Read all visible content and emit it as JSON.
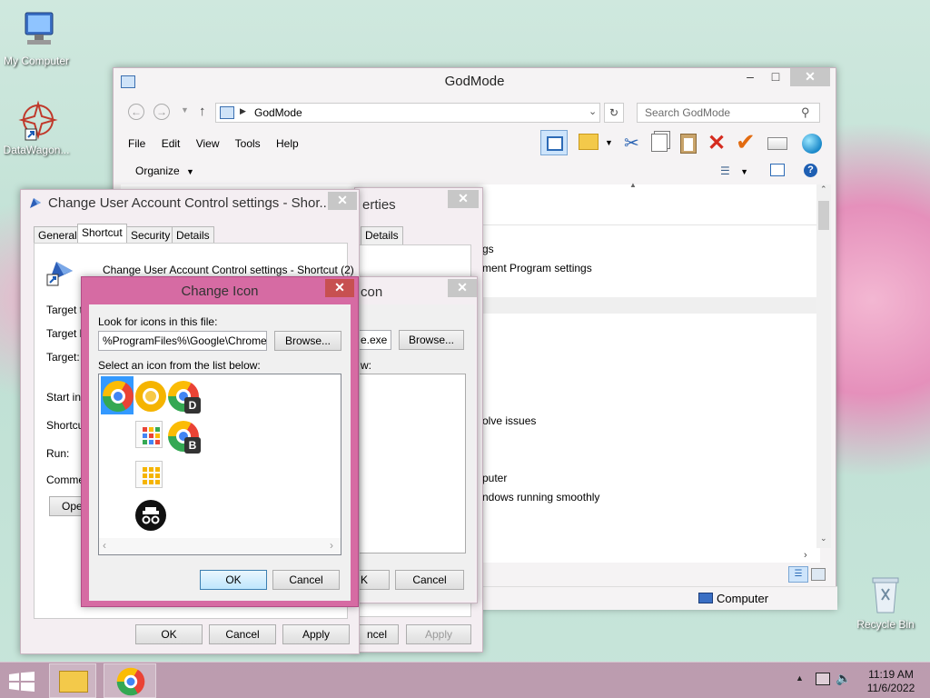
{
  "desktop": {
    "icons": [
      "My Computer",
      "DataWagon...",
      "Recycle Bin"
    ]
  },
  "explorer": {
    "title": "GodMode",
    "address": "GodMode",
    "search_placeholder": "Search GodMode",
    "menu": [
      "File",
      "Edit",
      "View",
      "Tools",
      "Help"
    ],
    "organize": "Organize",
    "content_lines": [
      "gs",
      "ment Program settings",
      "olve issues",
      "puter",
      "ndows running smoothly"
    ],
    "status": "Computer"
  },
  "props": {
    "title": "Change User Account Control settings - Shor...",
    "behind_title": "erties",
    "tabs": [
      "General",
      "Shortcut",
      "Security",
      "Details"
    ],
    "behind_tab": "Details",
    "shortcut_name": "Change User Account Control settings - Shortcut (2)",
    "labels": [
      "Target ty",
      "Target lo",
      "Target:",
      "Start in:",
      "Shortcut",
      "Run:",
      "Commer"
    ],
    "open_btn": "Ope",
    "ok": "OK",
    "cancel": "Cancel",
    "apply": "Apply",
    "behind_cancel": "ncel",
    "behind_apply": "Apply"
  },
  "behind_change_icon": {
    "title": "con",
    "path_tail": "e.exe",
    "browse": "Browse...",
    "list_label_tail": "w:",
    "cancel": "Cancel",
    "ok_tail": "K"
  },
  "change_icon": {
    "title": "Change Icon",
    "look_label": "Look for icons in this file:",
    "path": "%ProgramFiles%\\Google\\Chrome\\Ap",
    "browse": "Browse...",
    "select_label": "Select an icon from the list below:",
    "badge_d": "D",
    "badge_b": "B",
    "ok": "OK",
    "cancel": "Cancel"
  },
  "taskbar": {
    "time": "11:19 AM",
    "date": "11/6/2022"
  },
  "colors": {
    "accent": "#c45a8c",
    "close_red": "#c75050",
    "selection": "#3399ff"
  }
}
